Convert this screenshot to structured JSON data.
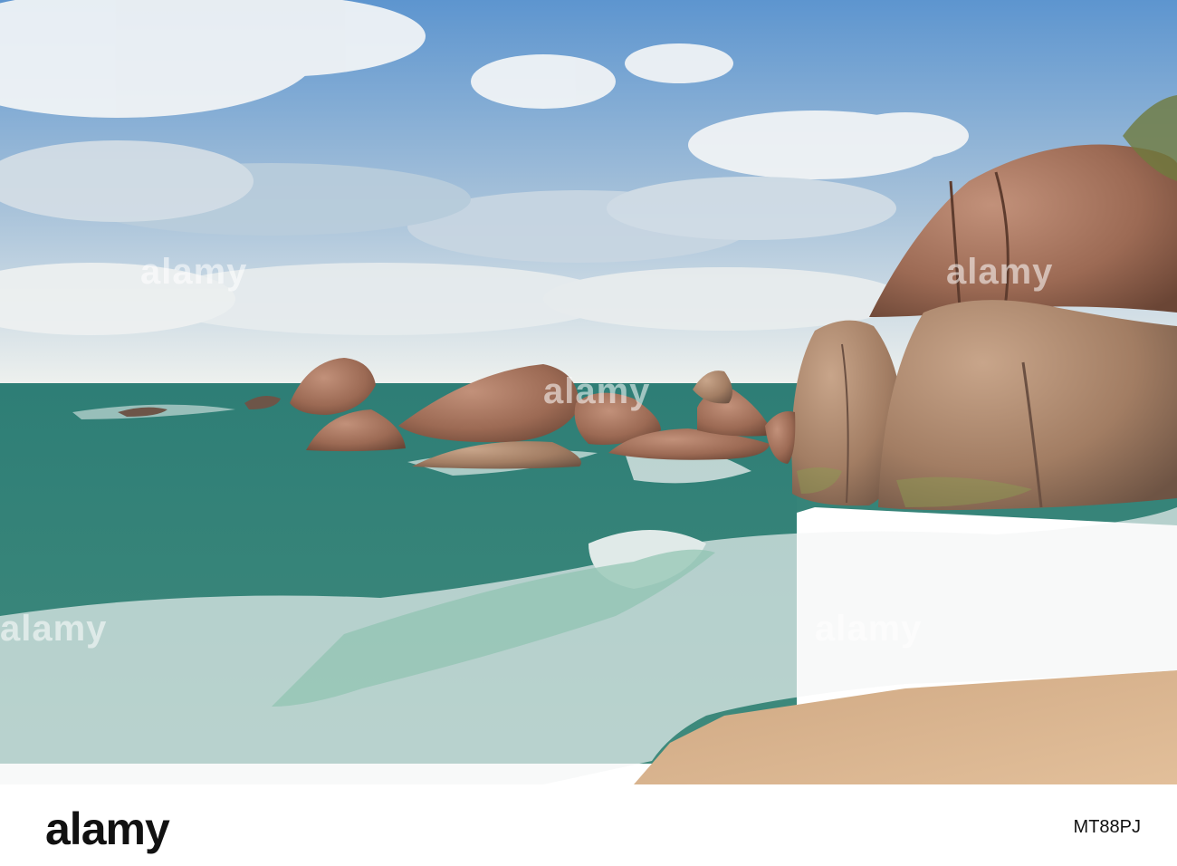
{
  "image": {
    "kind": "photograph",
    "scene": "tropical beach with granite boulders and breaking waves",
    "colors": {
      "sky_top": "#6a9cd0",
      "sky_bottom": "#e8eef0",
      "cloud": "#f4f6f8",
      "sea": "#2f7a6c",
      "sea_deep": "#245f58",
      "foam": "#f5f7f6",
      "sand": "#d9b48e",
      "rock": "#a8725a",
      "rock_dark": "#6b4634"
    }
  },
  "watermark": {
    "text": "alamy"
  },
  "footer": {
    "logo": "alamy",
    "image_id": "MT88PJ"
  }
}
